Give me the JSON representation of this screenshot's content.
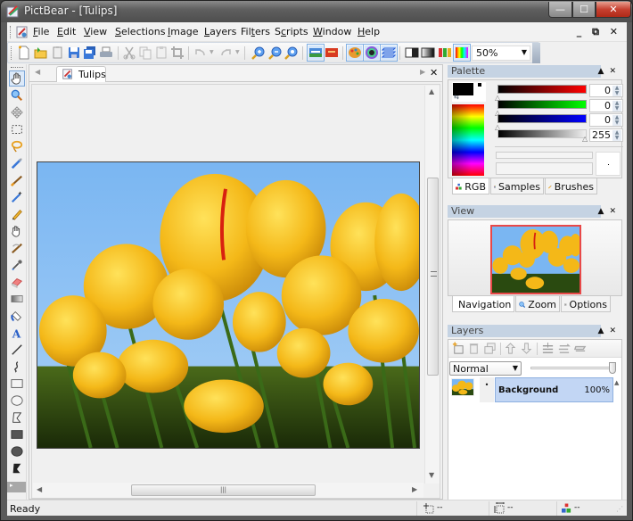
{
  "window": {
    "title": "PictBear - [Tulips]",
    "minimize": "—",
    "maximize": "☐",
    "close": "✕"
  },
  "menubar": {
    "items": [
      {
        "label": "File",
        "accel": "F"
      },
      {
        "label": "Edit",
        "accel": "E"
      },
      {
        "label": "View",
        "accel": "V"
      },
      {
        "label": "Selections",
        "accel": "S"
      },
      {
        "label": "Image",
        "accel": "I"
      },
      {
        "label": "Layers",
        "accel": "L"
      },
      {
        "label": "Filters",
        "accel": "t"
      },
      {
        "label": "Scripts",
        "accel": "c"
      },
      {
        "label": "Window",
        "accel": "W"
      },
      {
        "label": "Help",
        "accel": "H"
      }
    ],
    "mdi_controls": "_ ⧉ ✕"
  },
  "toolbar": {
    "buttons": [
      "new-file",
      "open-folder",
      "paste-new",
      "save",
      "save-all",
      "print",
      "cut",
      "copy",
      "paste",
      "crop",
      "undo",
      "redo",
      "zoom-in",
      "zoom-out",
      "zoom-actual",
      "image-view",
      "fullscreen",
      "palette",
      "navigator",
      "layers",
      "grayscale",
      "levels",
      "histogram",
      "color-balance"
    ],
    "zoom_value": "50%"
  },
  "toolbox": {
    "tools": [
      "hand",
      "zoom",
      "move",
      "rect-select",
      "lasso",
      "airbrush",
      "brush",
      "magic-wand",
      "pencil",
      "smudge",
      "clone",
      "eyedropper",
      "eraser",
      "gradient",
      "fill",
      "text",
      "line",
      "curve",
      "rectangle",
      "ellipse",
      "polygon",
      "filled-rectangle",
      "filled-ellipse",
      "filled-polygon"
    ],
    "active": "hand"
  },
  "document": {
    "tab_label": "Tulips",
    "image_description": "Yellow tulips against a blue sky"
  },
  "palette": {
    "title": "Palette",
    "red": "0",
    "green": "0",
    "blue": "0",
    "alpha": "255",
    "foreground": "#000000",
    "tabs": [
      "RGB",
      "Samples",
      "Brushes"
    ],
    "active_tab": "RGB"
  },
  "view_panel": {
    "title": "View",
    "tabs": [
      "Navigation",
      "Zoom",
      "Options"
    ],
    "active_tab": "Navigation"
  },
  "layers_panel": {
    "title": "Layers",
    "blend_mode": "Normal",
    "opacity_fraction": 1.0,
    "layers": [
      {
        "name": "Background",
        "opacity": "100%",
        "selected": true
      }
    ]
  },
  "status": {
    "text": "Ready",
    "position": "--",
    "size": "--",
    "color": "--"
  }
}
